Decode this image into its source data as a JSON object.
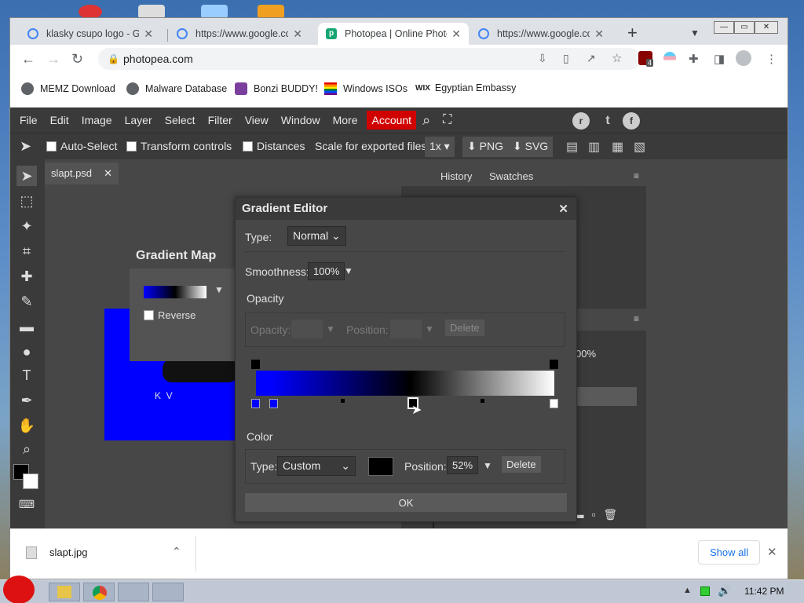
{
  "browser": {
    "tabs": [
      {
        "title": "klasky csupo logo - Goo",
        "active": false
      },
      {
        "title": "https://www.google.com",
        "active": false
      },
      {
        "title": "Photopea | Online Photo",
        "active": true
      },
      {
        "title": "https://www.google.com",
        "active": false
      }
    ],
    "new_tab": "+",
    "url": "photopea.com",
    "extension_badge": "4",
    "bookmarks": [
      "MEMZ Download",
      "Malware Database",
      "Bonzi BUDDY!",
      "Windows ISOs",
      "Egyptian Embassy"
    ],
    "bookmark_wix_prefix": "WIX"
  },
  "photopea": {
    "menu": [
      "File",
      "Edit",
      "Image",
      "Layer",
      "Select",
      "Filter",
      "View",
      "Window",
      "More"
    ],
    "account_label": "Account",
    "options": {
      "auto_select": "Auto-Select",
      "transform_controls": "Transform controls",
      "distances": "Distances",
      "scale_label": "Scale for exported files:",
      "scale_value": "1x",
      "png": "PNG",
      "svg": "SVG"
    },
    "doc_tab": "slapt.psd",
    "panel_tabs": [
      "History",
      "Swatches"
    ],
    "panel_value": "00%",
    "gradient_map": {
      "title": "Gradient Map",
      "reverse_label": "Reverse"
    },
    "gradient_editor": {
      "title": "Gradient Editor",
      "type_label": "Type:",
      "type_value": "Normal",
      "smoothness_label": "Smoothness:",
      "smoothness_value": "100%",
      "opacity_section": "Opacity",
      "opacity_label": "Opacity:",
      "position_label": "Position:",
      "delete_label": "Delete",
      "color_section": "Color",
      "color_type_label": "Type:",
      "color_type_value": "Custom",
      "color_position_label": "Position:",
      "color_position_value": "52%",
      "color_delete_label": "Delete",
      "ok_label": "OK",
      "gradient_colors": [
        "#0000ff",
        "#000000",
        "#ffffff"
      ],
      "swatch_color": "#000000"
    },
    "canvas_letters": "K  V"
  },
  "downloads": {
    "file": "slapt.jpg",
    "show_all": "Show all"
  },
  "taskbar": {
    "clock": "11:42 PM"
  }
}
